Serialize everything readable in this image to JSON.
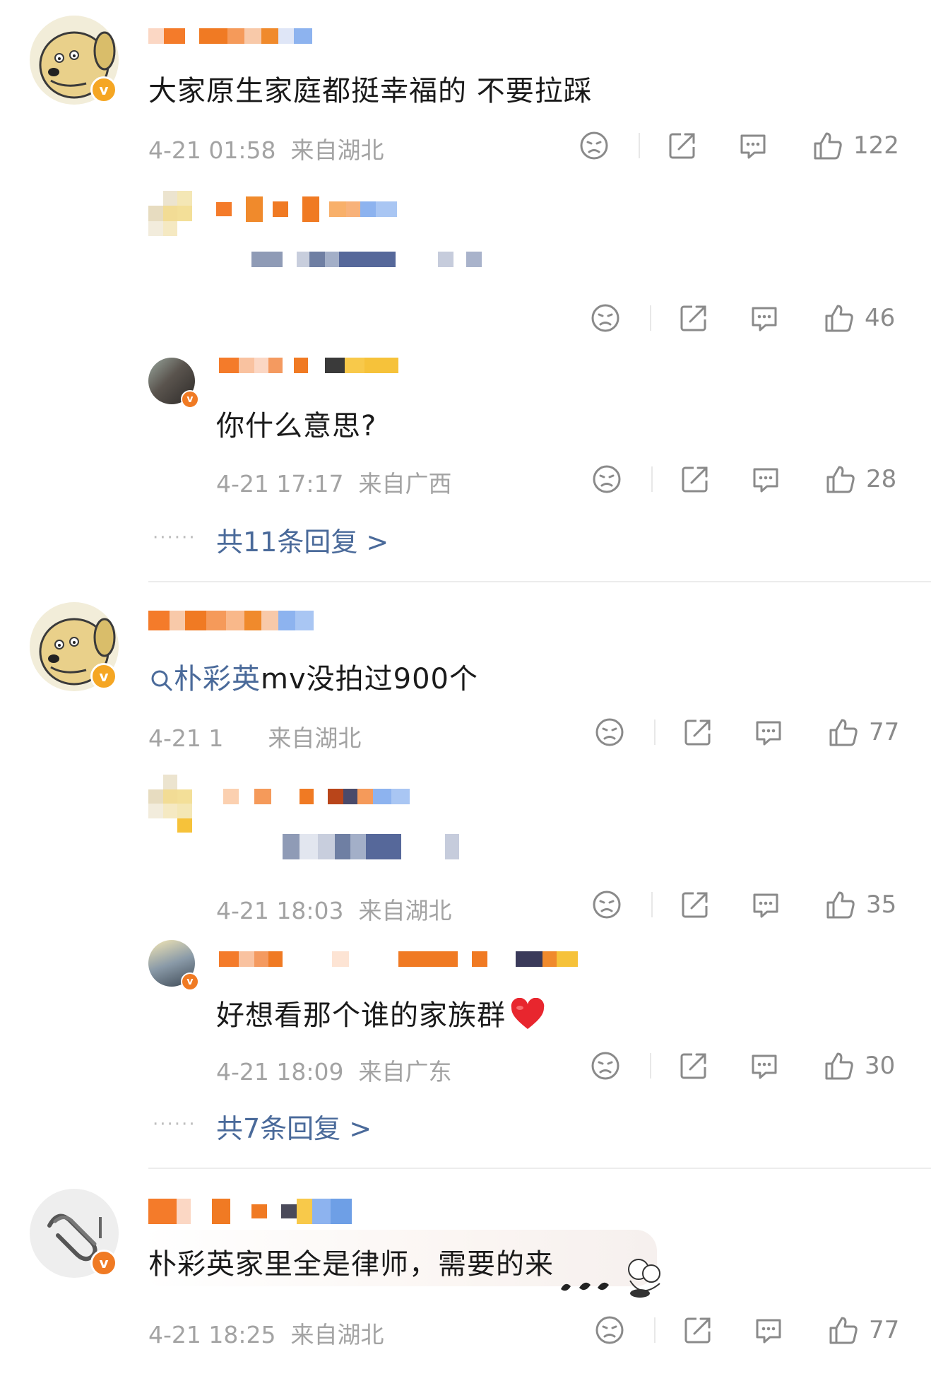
{
  "comments": [
    {
      "text": "大家原生家庭都挺幸福的 不要拉踩",
      "time": "4-21 01:58",
      "location": "来自湖北",
      "likes": "122",
      "replies": [
        {
          "text": "",
          "likes": "46"
        },
        {
          "text": "你什么意思?",
          "time": "4-21 17:17",
          "location": "来自广西",
          "likes": "28"
        }
      ],
      "more_replies": "共11条回复 >"
    },
    {
      "text_link": "朴彩英",
      "text_rest": "mv没拍过900个",
      "time": "4-21 1",
      "location": "来自湖北",
      "likes": "77",
      "replies": [
        {
          "text": "",
          "time": "4-21 18:03",
          "location": "来自湖北",
          "likes": "35"
        },
        {
          "text": "好想看那个谁的家族群",
          "time": "4-21 18:09",
          "location": "来自广东",
          "likes": "30"
        }
      ],
      "more_replies": "共7条回复 >"
    },
    {
      "text": "朴彩英家里全是律师，需要的来",
      "time": "4-21 18:25",
      "location": "来自湖北",
      "likes": "77"
    }
  ],
  "colors": {
    "link": "#4a6a9a",
    "meta": "#a3a3a3",
    "badge": "#f5a623",
    "heart": "#e8262e"
  },
  "icons": [
    "dislike-icon",
    "share-icon",
    "comment-icon",
    "like-icon",
    "search-icon",
    "verified-badge-icon",
    "heart-icon"
  ]
}
